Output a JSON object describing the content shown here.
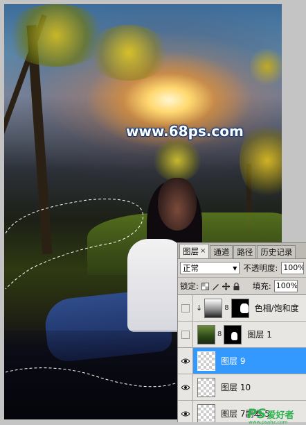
{
  "canvas": {
    "watermark": "www.68ps.com"
  },
  "layers_panel": {
    "tabs": [
      {
        "label": "图层",
        "active": true,
        "close": "×"
      },
      {
        "label": "通道",
        "active": false
      },
      {
        "label": "路径",
        "active": false
      },
      {
        "label": "历史记录",
        "active": false
      }
    ],
    "blend_mode": "正常",
    "opacity_label": "不透明度:",
    "opacity_value": "100%",
    "lock_label": "锁定:",
    "fill_label": "填充:",
    "fill_value": "100%",
    "layers": [
      {
        "name": "色相/饱和度",
        "visible": false,
        "selected": false,
        "thumb": "adjust",
        "has_mask": true,
        "clipped": true
      },
      {
        "name": "图层 1",
        "visible": false,
        "selected": false,
        "thumb": "photo",
        "has_mask": true,
        "clipped": false
      },
      {
        "name": "图层 9",
        "visible": true,
        "selected": true,
        "thumb": "transparent",
        "has_mask": false,
        "clipped": false
      },
      {
        "name": "图层 10",
        "visible": true,
        "selected": false,
        "thumb": "transparent",
        "has_mask": false,
        "clipped": false
      },
      {
        "name": "图层 7副本 5",
        "visible": true,
        "selected": false,
        "thumb": "transparent",
        "has_mask": false,
        "clipped": false
      }
    ]
  },
  "site_logo": {
    "mark": "PS",
    "name": "爱好者",
    "url": "www.psahz.com"
  },
  "colors": {
    "selected_layer": "#3399ff",
    "panel_bg": "#d6d3ce",
    "logo_green": "#2bb24c"
  },
  "icons": {
    "eye": "eye-icon",
    "link": "chain-link-icon",
    "lock_transparency": "lock-transparent-pixels-icon",
    "lock_image": "lock-image-pixels-icon",
    "lock_position": "lock-position-icon",
    "lock_all": "lock-all-icon"
  }
}
